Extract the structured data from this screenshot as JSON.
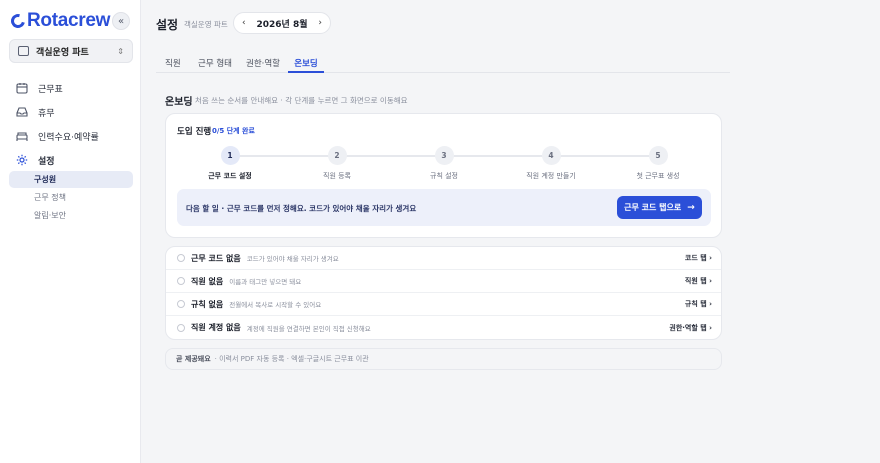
{
  "brand": {
    "name": "Rotacrew",
    "accent": "#2b4fd8"
  },
  "sidebar": {
    "collapse_icon": "«",
    "workspace": {
      "label": "객실운영 파트",
      "caret": "⌃⌄"
    },
    "items": [
      {
        "label": "근무표",
        "icon": "calendar-icon"
      },
      {
        "label": "휴무",
        "icon": "inbox-icon"
      },
      {
        "label": "인력수요·예약률",
        "icon": "bed-icon"
      },
      {
        "label": "설정",
        "icon": "gear-icon"
      }
    ],
    "sub_items": [
      {
        "label": "구성원",
        "active": true
      },
      {
        "label": "근무 정책"
      },
      {
        "label": "알림·보안"
      }
    ]
  },
  "header": {
    "title": "설정",
    "subtitle": "객실운영 파트",
    "month": "2026년 8월",
    "prev": "‹",
    "next": "›"
  },
  "tabs": [
    "직원",
    "근무 형태",
    "권한·역할",
    "온보딩"
  ],
  "onboarding": {
    "title": "온보딩",
    "desc": "처음 쓰는 순서를 안내해요 · 각 단계를 누르면 그 화면으로 이동해요",
    "progress_title": "도입 진행",
    "progress_count": "0/5 단계 완료",
    "steps": [
      {
        "num": "1",
        "label": "근무 코드 설정"
      },
      {
        "num": "2",
        "label": "직원 등록"
      },
      {
        "num": "3",
        "label": "규칙 설정"
      },
      {
        "num": "4",
        "label": "직원 계정 만들기"
      },
      {
        "num": "5",
        "label": "첫 근무표 생성"
      }
    ],
    "next_text": "다음 할 일 · 근무 코드를 먼저 정해요. 코드가 있어야 채울 자리가 생겨요",
    "next_button": "근무 코드 탭으로",
    "next_arrow": "→"
  },
  "checklist": [
    {
      "name": "근무 코드 없음",
      "desc": "코드가 있어야 채울 자리가 생겨요",
      "link": "코드 탭 ›"
    },
    {
      "name": "직원 없음",
      "desc": "이름과 태그만 넣으면 돼요",
      "link": "직원 탭 ›"
    },
    {
      "name": "규칙 없음",
      "desc": "전월에서 복사로 시작할 수 있어요",
      "link": "규칙 탭 ›"
    },
    {
      "name": "직원 계정 없음",
      "desc": "계정에 직원을 연결하면 본인이 직접 신청해요",
      "link": "권한·역할 탭 ›"
    }
  ],
  "footer": {
    "strong": "곧 제공돼요",
    "text": "· 이력서 PDF 자동 등록 · 엑셀·구글시트 근무표 이관"
  }
}
